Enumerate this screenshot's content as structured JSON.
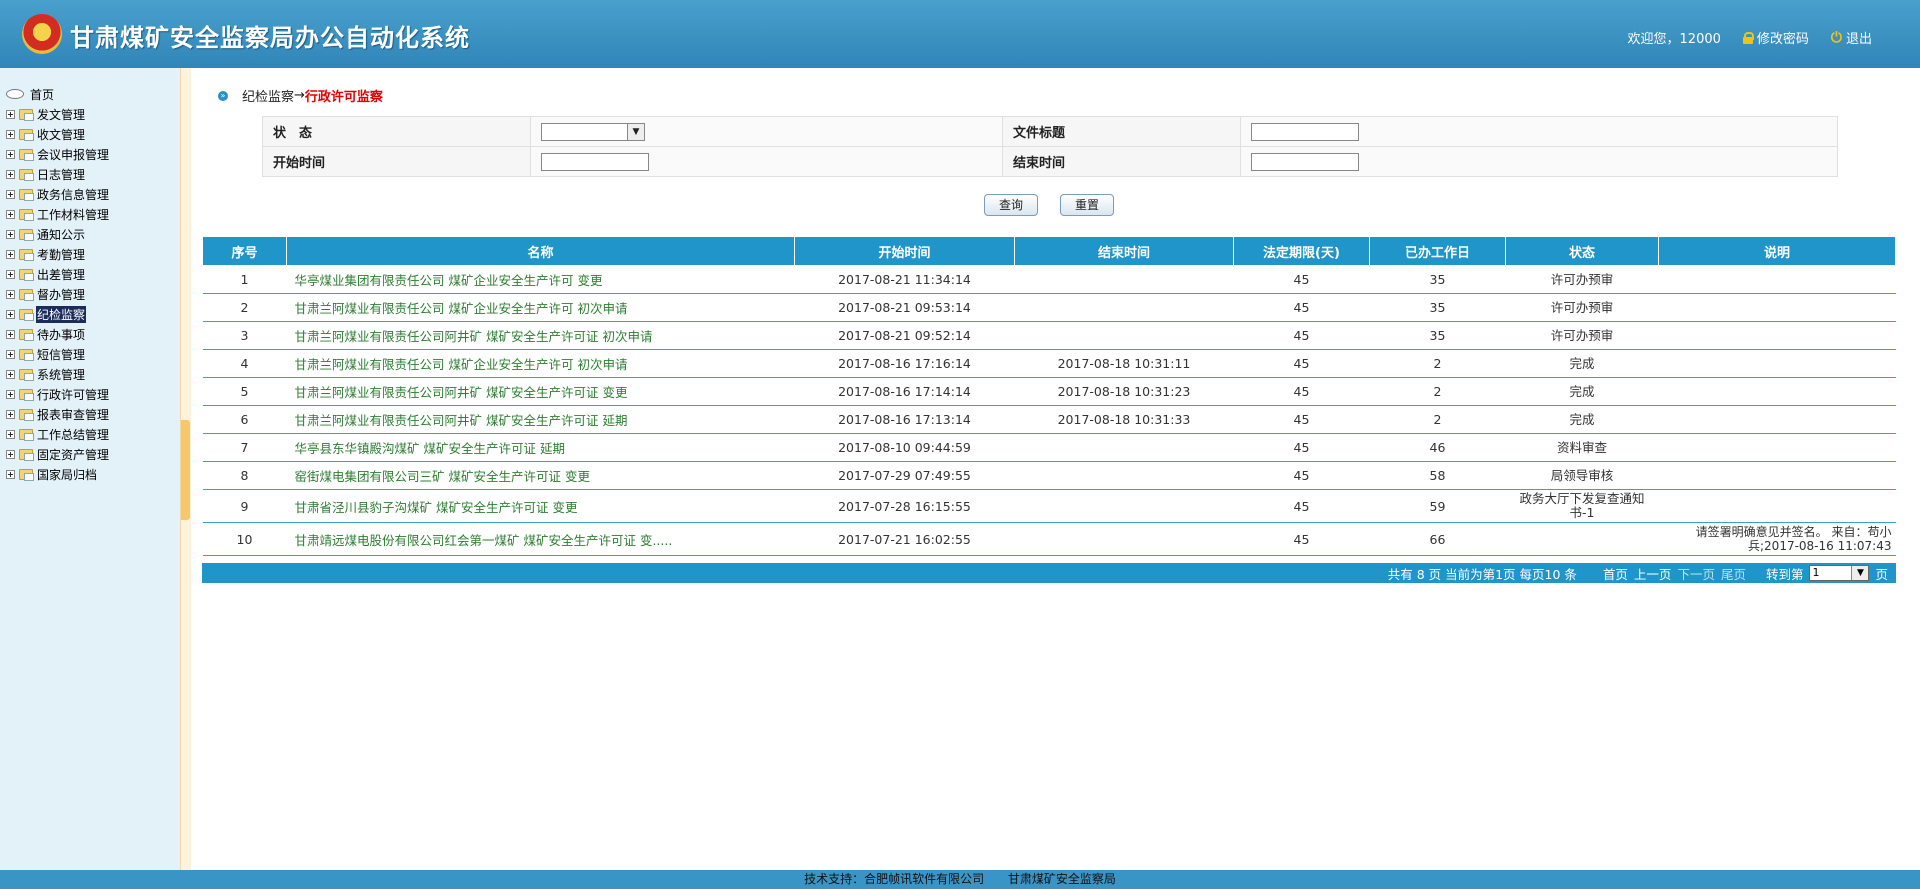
{
  "app": {
    "title": "甘肃煤矿安全监察局办公自动化系统",
    "welcome": "欢迎您，12000",
    "change_password": "修改密码",
    "logout": "退出"
  },
  "sidebar": {
    "root": "首页",
    "items": [
      {
        "label": "发文管理"
      },
      {
        "label": "收文管理"
      },
      {
        "label": "会议申报管理"
      },
      {
        "label": "日志管理"
      },
      {
        "label": "政务信息管理"
      },
      {
        "label": "工作材料管理"
      },
      {
        "label": "通知公示"
      },
      {
        "label": "考勤管理"
      },
      {
        "label": "出差管理"
      },
      {
        "label": "督办管理"
      },
      {
        "label": "纪检监察",
        "active": true
      },
      {
        "label": "待办事项"
      },
      {
        "label": "短信管理"
      },
      {
        "label": "系统管理"
      },
      {
        "label": "行政许可管理"
      },
      {
        "label": "报表审查管理"
      },
      {
        "label": "工作总结管理"
      },
      {
        "label": "固定资产管理"
      },
      {
        "label": "国家局归档"
      }
    ]
  },
  "breadcrumb": {
    "parent": "纪检监察",
    "arrow": "→",
    "current": "行政许可监察"
  },
  "filter": {
    "status_label": "状　态",
    "status_value": "",
    "title_label": "文件标题",
    "title_value": "",
    "start_label": "开始时间",
    "start_value": "",
    "end_label": "结束时间",
    "end_value": ""
  },
  "buttons": {
    "query": "查询",
    "reset": "重置"
  },
  "table": {
    "columns": [
      "序号",
      "名称",
      "开始时间",
      "结束时间",
      "法定期限(天)",
      "已办工作日",
      "状态",
      "说明"
    ],
    "rows": [
      [
        "1",
        "华亭煤业集团有限责任公司 煤矿企业安全生产许可 变更",
        "2017-08-21 11:34:14",
        "",
        "45",
        "35",
        "许可办预审",
        ""
      ],
      [
        "2",
        "甘肃兰阿煤业有限责任公司 煤矿企业安全生产许可 初次申请",
        "2017-08-21 09:53:14",
        "",
        "45",
        "35",
        "许可办预审",
        ""
      ],
      [
        "3",
        "甘肃兰阿煤业有限责任公司阿井矿 煤矿安全生产许可证 初次申请",
        "2017-08-21 09:52:14",
        "",
        "45",
        "35",
        "许可办预审",
        ""
      ],
      [
        "4",
        "甘肃兰阿煤业有限责任公司 煤矿企业安全生产许可 初次申请",
        "2017-08-16 17:16:14",
        "2017-08-18 10:31:11",
        "45",
        "2",
        "完成",
        ""
      ],
      [
        "5",
        "甘肃兰阿煤业有限责任公司阿井矿 煤矿安全生产许可证 变更",
        "2017-08-16 17:14:14",
        "2017-08-18 10:31:23",
        "45",
        "2",
        "完成",
        ""
      ],
      [
        "6",
        "甘肃兰阿煤业有限责任公司阿井矿 煤矿安全生产许可证 延期",
        "2017-08-16 17:13:14",
        "2017-08-18 10:31:33",
        "45",
        "2",
        "完成",
        ""
      ],
      [
        "7",
        "华亭县东华镇殿沟煤矿 煤矿安全生产许可证 延期",
        "2017-08-10 09:44:59",
        "",
        "45",
        "46",
        "资料审查",
        ""
      ],
      [
        "8",
        "窑街煤电集团有限公司三矿 煤矿安全生产许可证 变更",
        "2017-07-29 07:49:55",
        "",
        "45",
        "58",
        "局领导审核",
        ""
      ],
      [
        "9",
        "甘肃省泾川县豹子沟煤矿 煤矿安全生产许可证 变更",
        "2017-07-28 16:15:55",
        "",
        "45",
        "59",
        "政务大厅下发复查通知书-1",
        ""
      ],
      [
        "10",
        "甘肃靖远煤电股份有限公司红会第一煤矿 煤矿安全生产许可证 变.....",
        "2017-07-21 16:02:55",
        "",
        "45",
        "66",
        "",
        "请签署明确意见并签名。 来自：苟小兵;2017-08-16 11:07:43"
      ]
    ]
  },
  "pager": {
    "summary": "共有 8 页 当前为第1页 每页10 条",
    "first": "首页",
    "prev": "上一页",
    "next": "下一页",
    "last": "尾页",
    "goto": "转到第",
    "page_value": "1",
    "page_suffix": "页"
  },
  "footer": {
    "support": "技术支持：合肥帧讯软件有限公司",
    "org": "甘肃煤矿安全监察局"
  }
}
